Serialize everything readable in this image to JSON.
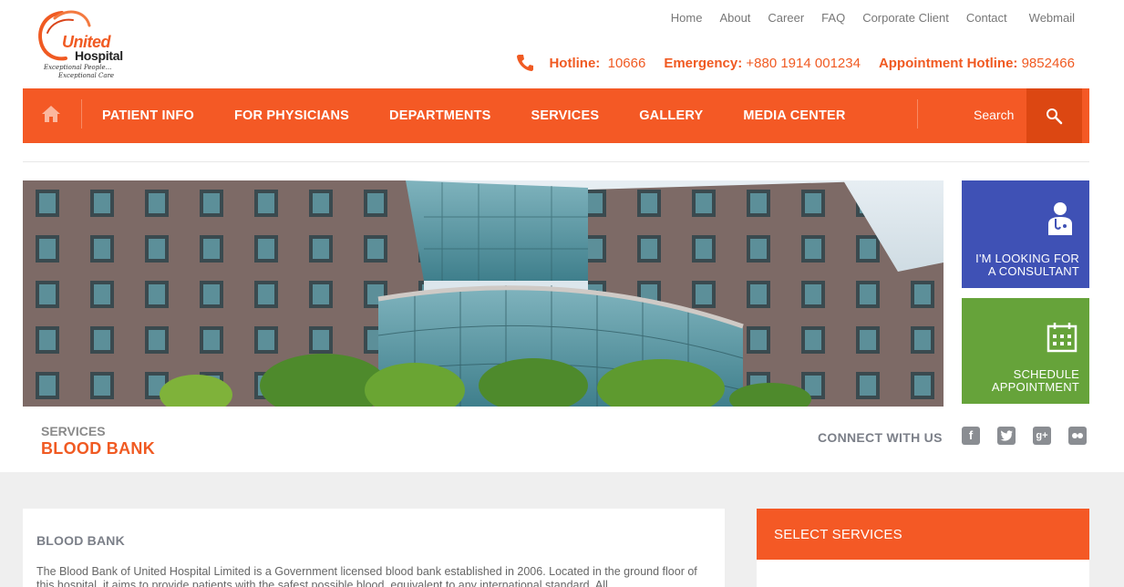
{
  "logo": {
    "line1": "United",
    "line2": "Hospital",
    "tagline1": "Exceptional People...",
    "tagline2": "Exceptional Care"
  },
  "top_links": [
    "Home",
    "About",
    "Career",
    "FAQ",
    "Corporate Client",
    "Contact",
    "Webmail"
  ],
  "hotlines": {
    "hotline_label": "Hotline:",
    "hotline_value": "10666",
    "emergency_label": "Emergency:",
    "emergency_value": "+880 1914 001234",
    "appointment_label": "Appointment Hotline:",
    "appointment_value": "9852466"
  },
  "nav": {
    "items": [
      "PATIENT INFO",
      "FOR PHYSICIANS",
      "DEPARTMENTS",
      "SERVICES",
      "GALLERY",
      "MEDIA CENTER"
    ],
    "search_label": "Search"
  },
  "tiles": {
    "consultant": "I'M LOOKING FOR\nA CONSULTANT",
    "appointment": "SCHEDULE\nAPPOINTMENT"
  },
  "breadcrumb": {
    "section": "SERVICES",
    "title": "BLOOD BANK"
  },
  "connect_label": "CONNECT WITH US",
  "social": [
    "facebook-icon",
    "twitter-icon",
    "googleplus-icon",
    "flickr-icon"
  ],
  "content": {
    "heading": "BLOOD BANK",
    "body": "The Blood Bank of United Hospital Limited is a Government licensed blood bank established in 2006.  Located in the ground floor of this hospital, it aims to provide patients with the safest possible blood, equivalent to any international standard. All"
  },
  "sidebar": {
    "select_services": "SELECT SERVICES"
  },
  "colors": {
    "accent": "#f45925",
    "tile_blue": "#3f51b5",
    "tile_green": "#66a33a"
  }
}
